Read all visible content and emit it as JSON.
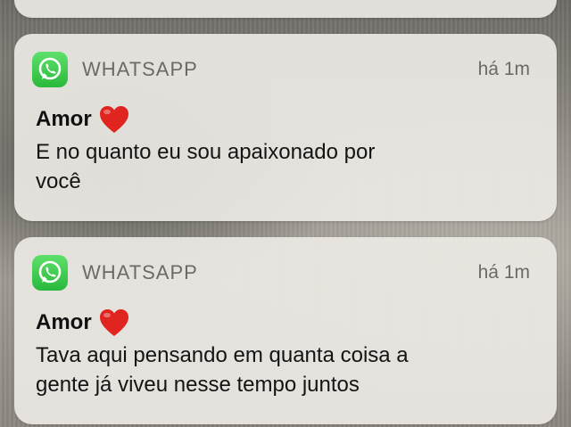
{
  "notifications": [
    {
      "app_name": "WHATSAPP",
      "time": "há 1m",
      "title": "Amor",
      "title_emoji": "red-heart",
      "message_line1": "E no quanto eu sou apaixonado por",
      "message_line2": "você"
    },
    {
      "app_name": "WHATSAPP",
      "time": "há 1m",
      "title": "Amor",
      "title_emoji": "red-heart",
      "message_line1": "Tava aqui pensando em quanta coisa a",
      "message_line2": "gente já viveu nesse tempo juntos"
    }
  ],
  "colors": {
    "whatsapp_green": "#2fbf43",
    "heart_red": "#e0241f"
  }
}
